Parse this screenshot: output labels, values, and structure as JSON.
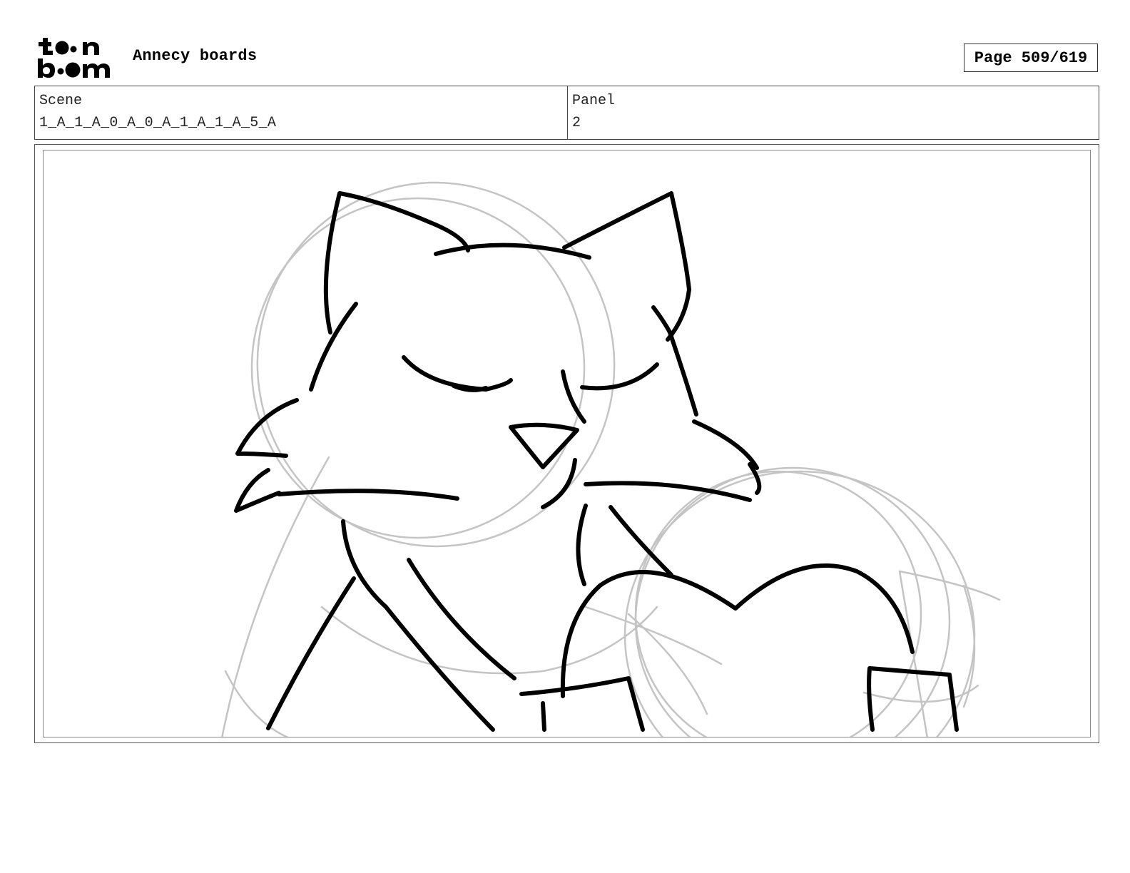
{
  "header": {
    "logo_text": "toonboom",
    "doc_title": "Annecy boards",
    "page_label": "Page 509/619"
  },
  "info": {
    "scene_label": "Scene",
    "scene_value": "1_A_1_A_0_A_0_A_1_A_1_A_5_A",
    "panel_label": "Panel",
    "panel_value": "2"
  },
  "artwork": {
    "subject": "cat-character-sketch",
    "rough_stroke_color": "#c4c4c4",
    "ink_stroke_color": "#000000"
  }
}
